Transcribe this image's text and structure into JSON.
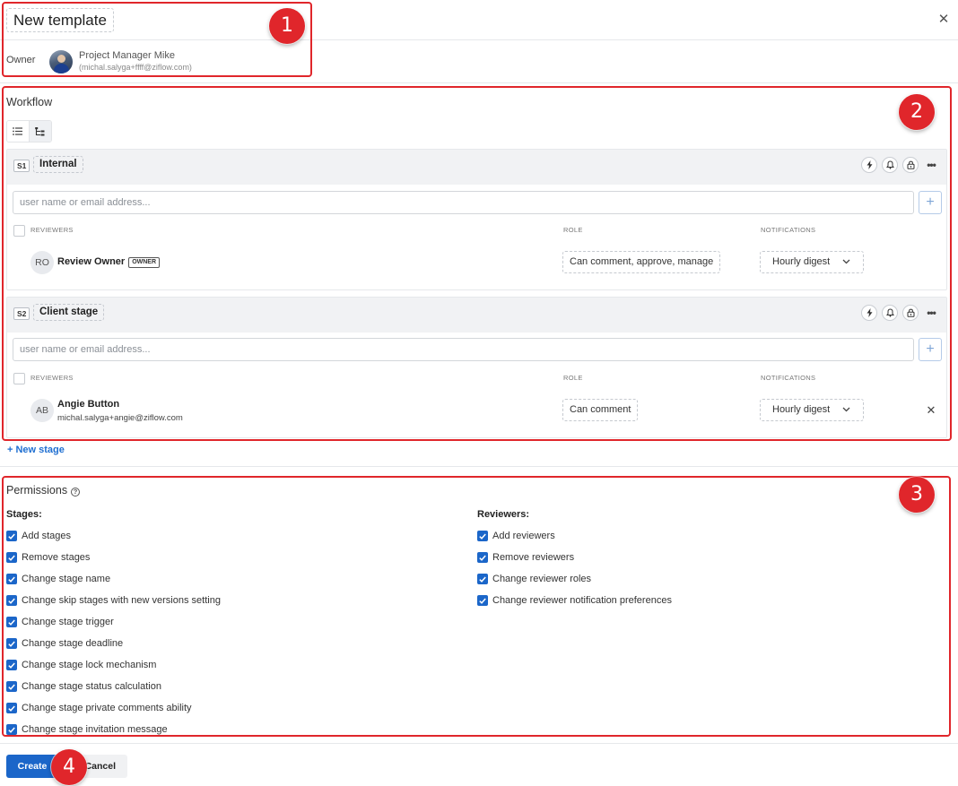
{
  "header": {
    "title": "New template",
    "owner_label": "Owner",
    "owner_name": "Project Manager Mike",
    "owner_email": "(michal.salyga+ffff@ziflow.com)"
  },
  "workflow": {
    "title": "Workflow",
    "input_placeholder": "user name or email address...",
    "col_reviewers": "REVIEWERS",
    "col_role": "ROLE",
    "col_notifications": "NOTIFICATIONS",
    "stages": [
      {
        "badge": "S1",
        "name": "Internal",
        "reviewer": {
          "initials": "RO",
          "name": "Review Owner",
          "tag": "OWNER",
          "email": "",
          "role": "Can comment, approve, manage",
          "notifications": "Hourly digest"
        }
      },
      {
        "badge": "S2",
        "name": "Client stage",
        "reviewer": {
          "initials": "AB",
          "name": "Angie Button",
          "email": "michal.salyga+angie@ziflow.com",
          "role": "Can comment",
          "notifications": "Hourly digest"
        }
      }
    ],
    "new_stage_label": "+ New stage"
  },
  "permissions": {
    "title": "Permissions",
    "stages_heading": "Stages:",
    "reviewers_heading": "Reviewers:",
    "stage_items": [
      "Add stages",
      "Remove stages",
      "Change stage name",
      "Change skip stages with new versions setting",
      "Change stage trigger",
      "Change stage deadline",
      "Change stage lock mechanism",
      "Change stage status calculation",
      "Change stage private comments ability",
      "Change stage invitation message"
    ],
    "reviewer_items": [
      "Add reviewers",
      "Remove reviewers",
      "Change reviewer roles",
      "Change reviewer notification preferences"
    ]
  },
  "footer": {
    "create_label": "Create",
    "cancel_label": "Cancel"
  },
  "annotations": [
    "1",
    "2",
    "3",
    "4"
  ],
  "colors": {
    "accent": "#1b66c9",
    "annotation": "#e0262b"
  }
}
